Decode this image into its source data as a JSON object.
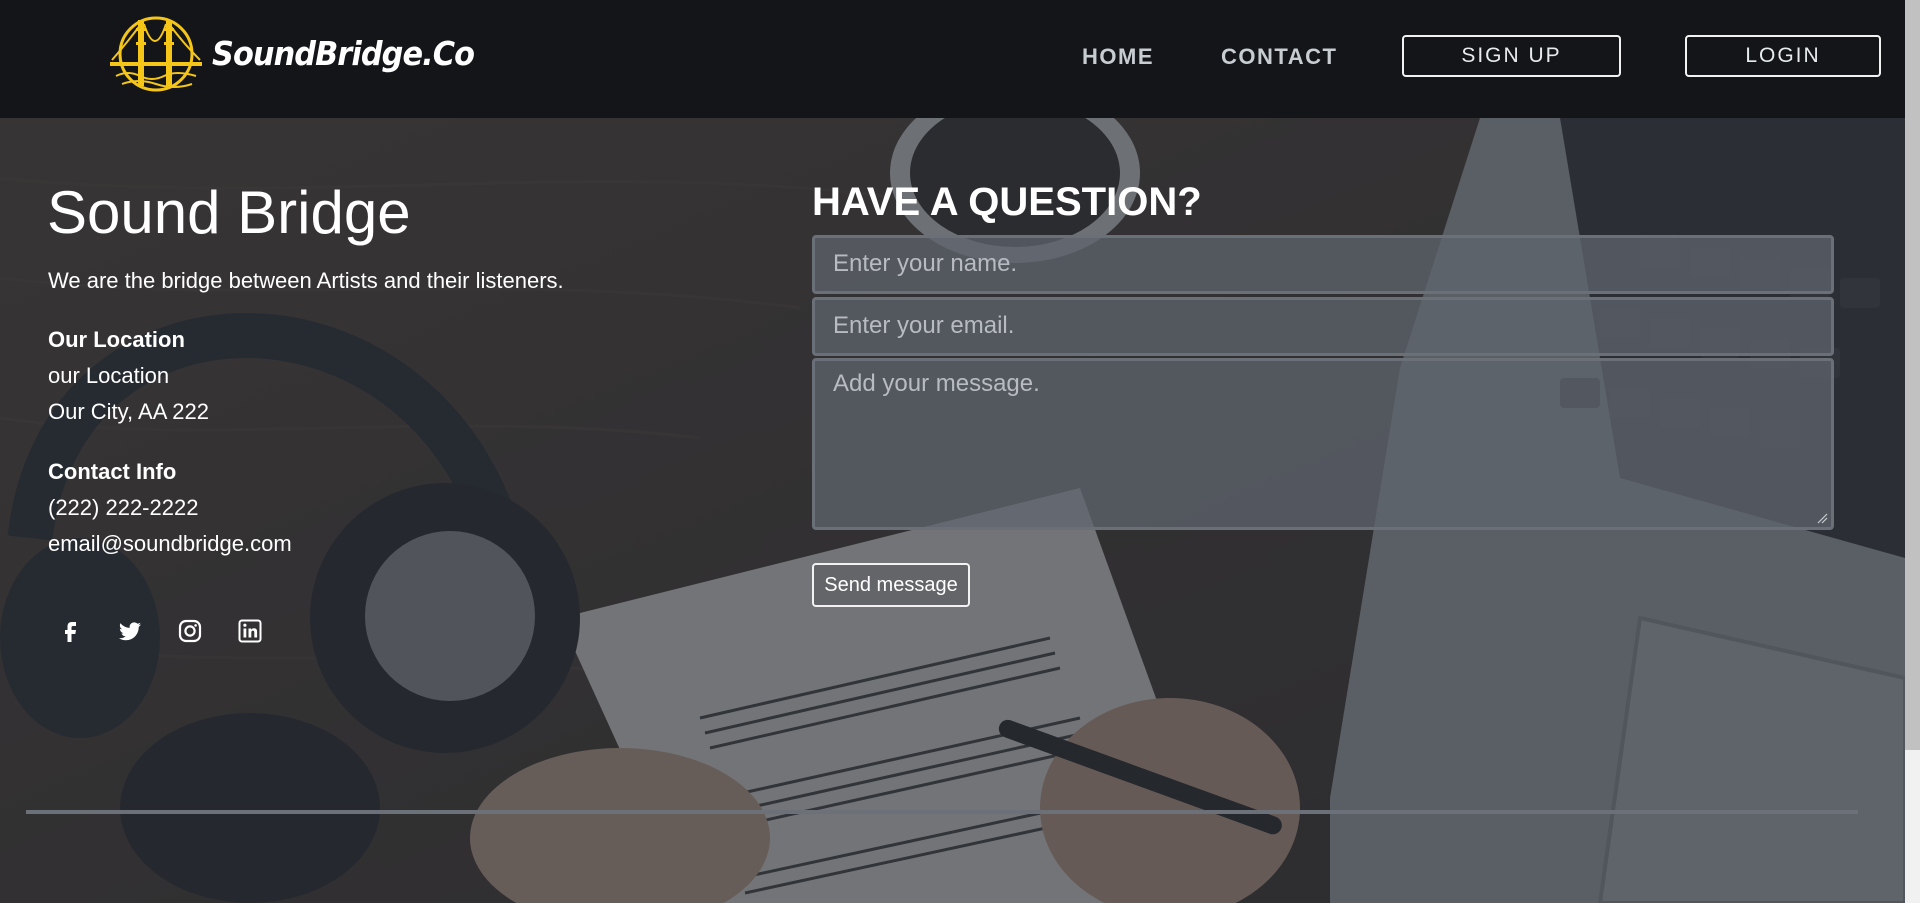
{
  "header": {
    "brand": "SoundBridge.Co",
    "logo_icon": "golden-gate-bridge-icon",
    "nav": [
      {
        "label": "HOME"
      },
      {
        "label": "CONTACT"
      }
    ],
    "signup_label": "SIGN UP",
    "login_label": "LOGIN"
  },
  "about": {
    "title": "Sound Bridge",
    "tagline": "We are the bridge between Artists and their listeners.",
    "location_heading": "Our Location",
    "location_line1": "our Location",
    "location_line2": "Our City, AA 222",
    "contact_heading": "Contact Info",
    "phone": "(222) 222-2222",
    "email": "email@soundbridge.com",
    "social": [
      "facebook-icon",
      "twitter-icon",
      "instagram-icon",
      "linkedin-icon"
    ]
  },
  "form": {
    "title": "HAVE A QUESTION?",
    "name_placeholder": "Enter your name.",
    "email_placeholder": "Enter your email.",
    "message_placeholder": "Add your message.",
    "submit_label": "Send message"
  },
  "colors": {
    "navbar_bg": "#131519",
    "logo_accent": "#f5c518",
    "text": "#ffffff",
    "field_bg": "#5f646e"
  }
}
